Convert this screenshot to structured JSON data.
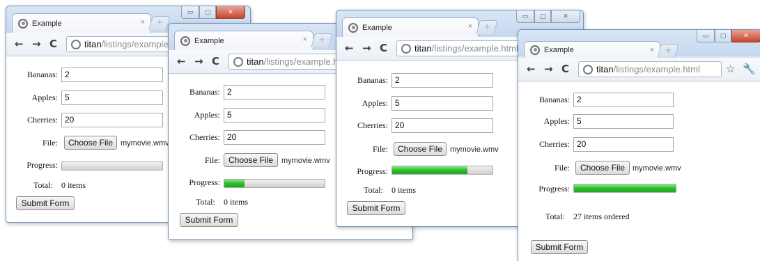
{
  "windows": [
    {
      "tab_title": "Example",
      "url_host": "titan",
      "url_path": "/listings/example.html",
      "form": {
        "bananas_label": "Bananas:",
        "bananas_value": "2",
        "apples_label": "Apples:",
        "apples_value": "5",
        "cherries_label": "Cherries:",
        "cherries_value": "20",
        "file_label": "File:",
        "choose_file_label": "Choose File",
        "file_name": "mymovie.wmv",
        "progress_label": "Progress:",
        "progress_value": 0,
        "total_label": "Total:",
        "total_value": "0 items",
        "submit_label": "Submit Form"
      }
    },
    {
      "tab_title": "Example",
      "url_host": "titan",
      "url_path": "/listings/example.html",
      "form": {
        "bananas_label": "Bananas:",
        "bananas_value": "2",
        "apples_label": "Apples:",
        "apples_value": "5",
        "cherries_label": "Cherries:",
        "cherries_value": "20",
        "file_label": "File:",
        "choose_file_label": "Choose File",
        "file_name": "mymovie.wmv",
        "progress_label": "Progress:",
        "progress_value": 0.2,
        "total_label": "Total:",
        "total_value": "0 items",
        "submit_label": "Submit Form"
      }
    },
    {
      "tab_title": "Example",
      "url_host": "titan",
      "url_path": "/listings/example.html",
      "form": {
        "bananas_label": "Bananas:",
        "bananas_value": "2",
        "apples_label": "Apples:",
        "apples_value": "5",
        "cherries_label": "Cherries:",
        "cherries_value": "20",
        "file_label": "File:",
        "choose_file_label": "Choose File",
        "file_name": "mymovie.wmv",
        "progress_label": "Progress:",
        "progress_value": 0.75,
        "total_label": "Total:",
        "total_value": "0 items",
        "submit_label": "Submit Form"
      }
    },
    {
      "tab_title": "Example",
      "url_host": "titan",
      "url_path": "/listings/example.html",
      "form": {
        "bananas_label": "Bananas:",
        "bananas_value": "2",
        "apples_label": "Apples:",
        "apples_value": "5",
        "cherries_label": "Cherries:",
        "cherries_value": "20",
        "file_label": "File:",
        "choose_file_label": "Choose File",
        "file_name": "mymovie.wmv",
        "progress_label": "Progress:",
        "progress_value": 1,
        "total_label": "Total:",
        "total_value": "27 items ordered",
        "submit_label": "Submit Form"
      }
    }
  ],
  "colors": {
    "progress_fill": "#2bbd2b",
    "window_close": "#c8442f",
    "url_path": "#8a8a8a"
  },
  "icons": [
    "back-arrow-icon",
    "forward-arrow-icon",
    "reload-icon",
    "page-globe-icon",
    "bookmark-star-icon",
    "wrench-menu-icon",
    "tab-favicon-icon",
    "tab-close-icon",
    "new-tab-icon",
    "minimize-icon",
    "maximize-icon",
    "window-close-icon"
  ]
}
